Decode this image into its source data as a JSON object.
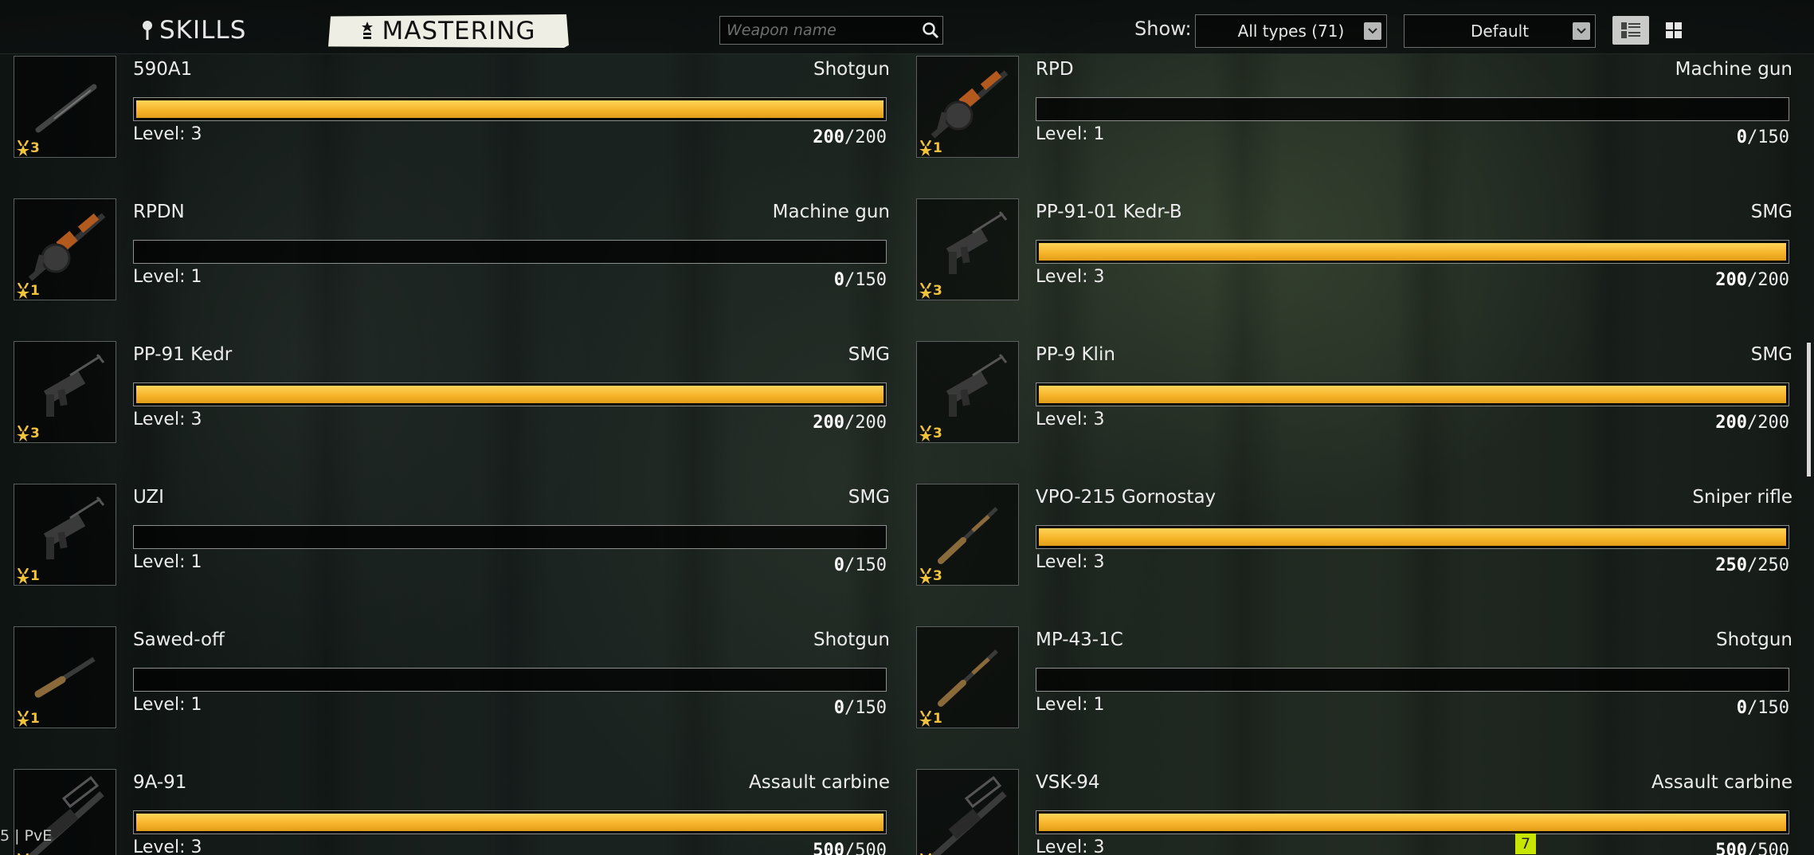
{
  "header": {
    "tabs": [
      {
        "label": "SKILLS",
        "icon": "pin-icon",
        "active": false
      },
      {
        "label": "MASTERING",
        "icon": "rank-icon",
        "active": true
      }
    ],
    "search": {
      "placeholder": "Weapon name",
      "value": "",
      "icon": "search-icon"
    },
    "show_label": "Show:",
    "type_filter": "All types (71)",
    "sort": "Default",
    "view_modes": [
      "list-view-icon",
      "grid-view-icon"
    ],
    "active_view": "list"
  },
  "colors": {
    "bar_fill": "#f6b52b",
    "medal": "#f2c23a",
    "tab_active_bg": "#efeee4"
  },
  "weapons": [
    {
      "name": "590A1",
      "type": "Shotgun",
      "level_text": "Level: 3",
      "current": "200",
      "max": "/200",
      "fraction": 1,
      "medal_level": "3",
      "gun": "shotgun-icon"
    },
    {
      "name": "RPD",
      "type": "Machine gun",
      "level_text": "Level: 1",
      "current": "0",
      "max": "/150",
      "fraction": 0,
      "medal_level": "1",
      "gun": "machine-gun-icon"
    },
    {
      "name": "RPDN",
      "type": "Machine gun",
      "level_text": "Level: 1",
      "current": "0",
      "max": "/150",
      "fraction": 0,
      "medal_level": "1",
      "gun": "machine-gun-icon"
    },
    {
      "name": "PP-91-01 Kedr-B",
      "type": "SMG",
      "level_text": "Level: 3",
      "current": "200",
      "max": "/200",
      "fraction": 1,
      "medal_level": "3",
      "gun": "smg-icon"
    },
    {
      "name": "PP-91 Kedr",
      "type": "SMG",
      "level_text": "Level: 3",
      "current": "200",
      "max": "/200",
      "fraction": 1,
      "medal_level": "3",
      "gun": "smg-icon"
    },
    {
      "name": "PP-9 Klin",
      "type": "SMG",
      "level_text": "Level: 3",
      "current": "200",
      "max": "/200",
      "fraction": 1,
      "medal_level": "3",
      "gun": "smg-icon"
    },
    {
      "name": "UZI",
      "type": "SMG",
      "level_text": "Level: 1",
      "current": "0",
      "max": "/150",
      "fraction": 0,
      "medal_level": "1",
      "gun": "smg-icon"
    },
    {
      "name": "VPO-215 Gornostay",
      "type": "Sniper rifle",
      "level_text": "Level: 3",
      "current": "250",
      "max": "/250",
      "fraction": 1,
      "medal_level": "3",
      "gun": "rifle-icon"
    },
    {
      "name": "Sawed-off",
      "type": "Shotgun",
      "level_text": "Level: 1",
      "current": "0",
      "max": "/150",
      "fraction": 0,
      "medal_level": "1",
      "gun": "sawed-off-icon"
    },
    {
      "name": "MP-43-1C",
      "type": "Shotgun",
      "level_text": "Level: 1",
      "current": "0",
      "max": "/150",
      "fraction": 0,
      "medal_level": "1",
      "gun": "rifle-icon"
    },
    {
      "name": "9A-91",
      "type": "Assault carbine",
      "level_text": "Level: 3",
      "current": "500",
      "max": "/500",
      "fraction": 1,
      "medal_level": "",
      "gun": "carbine-icon"
    },
    {
      "name": "VSK-94",
      "type": "Assault carbine",
      "level_text": "Level: 3",
      "current": "500",
      "max": "/500",
      "fraction": 1,
      "medal_level": "",
      "gun": "carbine-icon"
    }
  ],
  "footer": {
    "edge_text": "5",
    "mode_label": "PvE",
    "notification_count": "7"
  }
}
